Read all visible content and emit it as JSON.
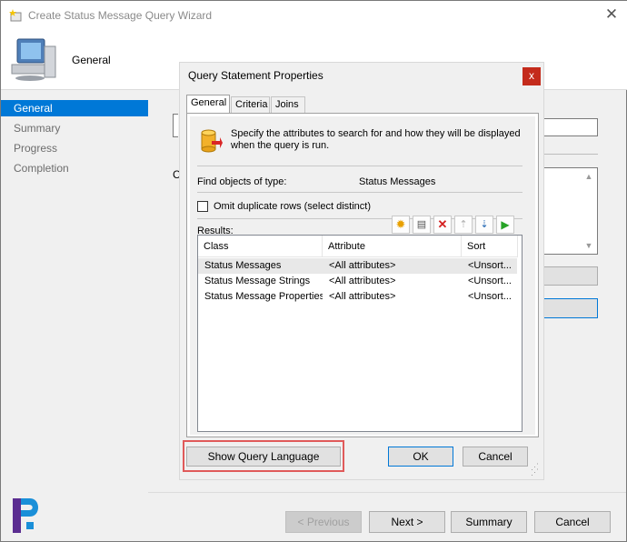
{
  "window": {
    "title": "Create Status Message Query Wizard",
    "header": "General"
  },
  "nav": {
    "items": [
      {
        "label": "General",
        "selected": true
      },
      {
        "label": "Summary",
        "selected": false
      },
      {
        "label": "Progress",
        "selected": false
      },
      {
        "label": "Completion",
        "selected": false
      }
    ]
  },
  "background": {
    "truncated_label": "C"
  },
  "wizard_buttons": {
    "previous": "< Previous",
    "next": "Next >",
    "summary": "Summary",
    "cancel": "Cancel"
  },
  "dialog": {
    "title": "Query Statement Properties",
    "close": "x",
    "tabs": [
      "General",
      "Criteria",
      "Joins"
    ],
    "description": "Specify the attributes to search for and how they will be displayed when the query is run.",
    "object_type_label": "Find objects of type:",
    "object_type_value": "Status Messages",
    "omit_duplicates_label": "Omit duplicate rows (select distinct)",
    "results_label": "Results:",
    "columns": [
      "Class",
      "Attribute",
      "Sort"
    ],
    "rows": [
      {
        "class": "Status Messages",
        "attribute": "<All attributes>",
        "sort": "<Unsort..."
      },
      {
        "class": "Status Message Strings",
        "attribute": "<All attributes>",
        "sort": "<Unsort..."
      },
      {
        "class": "Status Message Properties",
        "attribute": "<All attributes>",
        "sort": "<Unsort..."
      }
    ],
    "show_query_language": "Show Query Language",
    "ok": "OK",
    "cancel": "Cancel"
  },
  "colors": {
    "selection": "#0078d7",
    "close_red": "#c42b1c",
    "highlight": "#e05a5a"
  }
}
